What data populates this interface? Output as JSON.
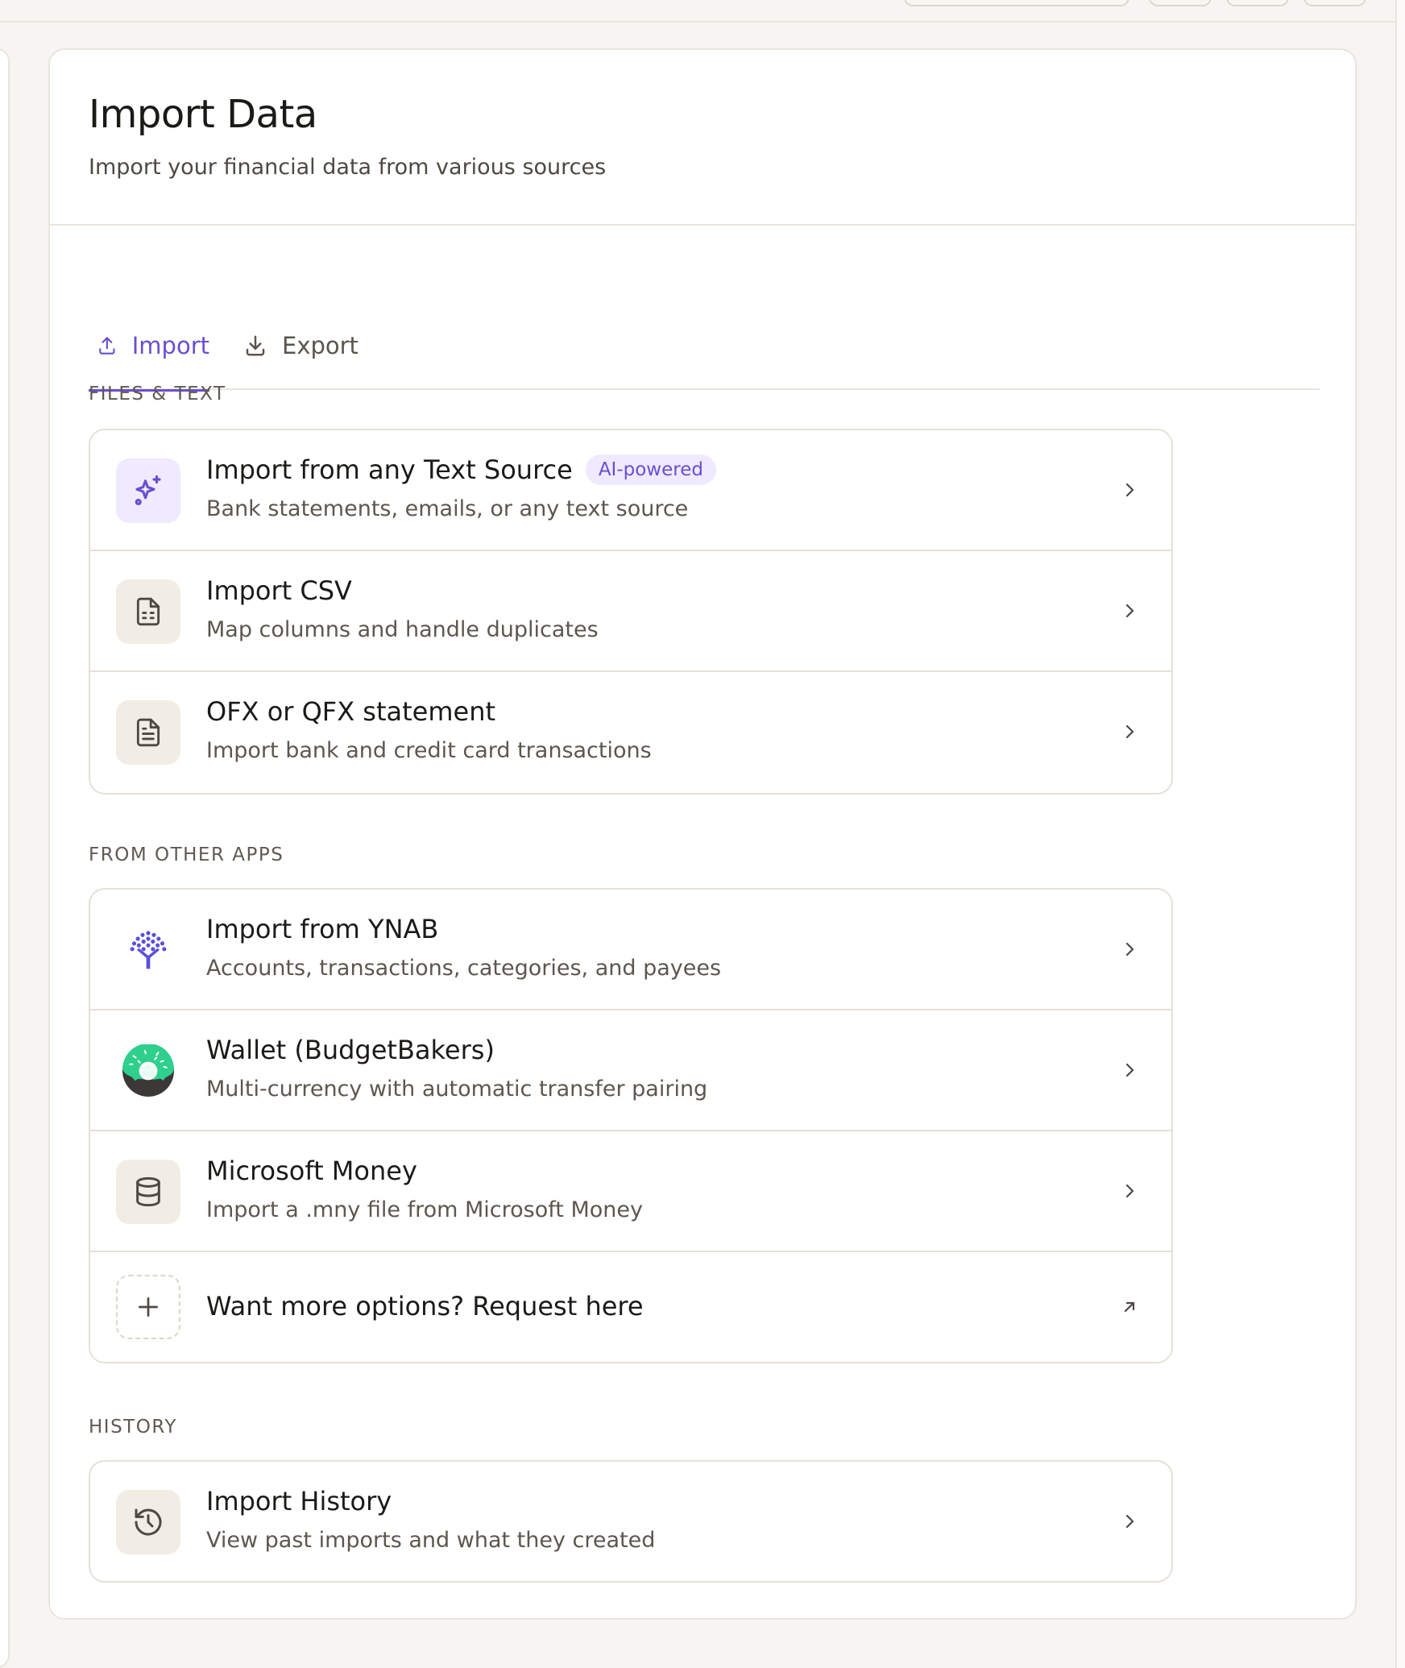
{
  "header": {
    "title": "Import Data",
    "subtitle": "Import your financial data from various sources"
  },
  "tabs": [
    {
      "label": "Import",
      "icon": "upload-icon",
      "active": true
    },
    {
      "label": "Export",
      "icon": "download-icon",
      "active": false
    }
  ],
  "sections": {
    "files_text": {
      "label": "FILES & TEXT",
      "items": [
        {
          "title": "Import from any Text Source",
          "badge": "AI-powered",
          "desc": "Bank statements, emails, or any text source",
          "icon": "sparkles-icon"
        },
        {
          "title": "Import CSV",
          "desc": "Map columns and handle duplicates",
          "icon": "spreadsheet-file-icon"
        },
        {
          "title": "OFX or QFX statement",
          "desc": "Import bank and credit card transactions",
          "icon": "document-file-icon"
        }
      ]
    },
    "other_apps": {
      "label": "FROM OTHER APPS",
      "items": [
        {
          "title": "Import from YNAB",
          "desc": "Accounts, transactions, categories, and payees",
          "icon": "ynab-tree-logo-icon"
        },
        {
          "title": "Wallet (BudgetBakers)",
          "desc": "Multi-currency with automatic transfer pairing",
          "icon": "budgetbakers-donut-logo-icon"
        },
        {
          "title": "Microsoft Money",
          "desc": "Import a .mny file from Microsoft Money",
          "icon": "database-icon"
        },
        {
          "title": "Want more options? Request here",
          "icon": "plus-icon",
          "action_icon": "external-arrow-icon"
        }
      ]
    },
    "history": {
      "label": "HISTORY",
      "items": [
        {
          "title": "Import History",
          "desc": "View past imports and what they created",
          "icon": "history-clock-icon"
        }
      ]
    }
  },
  "colors": {
    "accent": "#6a4fd0",
    "background": "#f7f5f2",
    "border": "#e5e0d8",
    "icon_bg": "#f2ede4"
  }
}
